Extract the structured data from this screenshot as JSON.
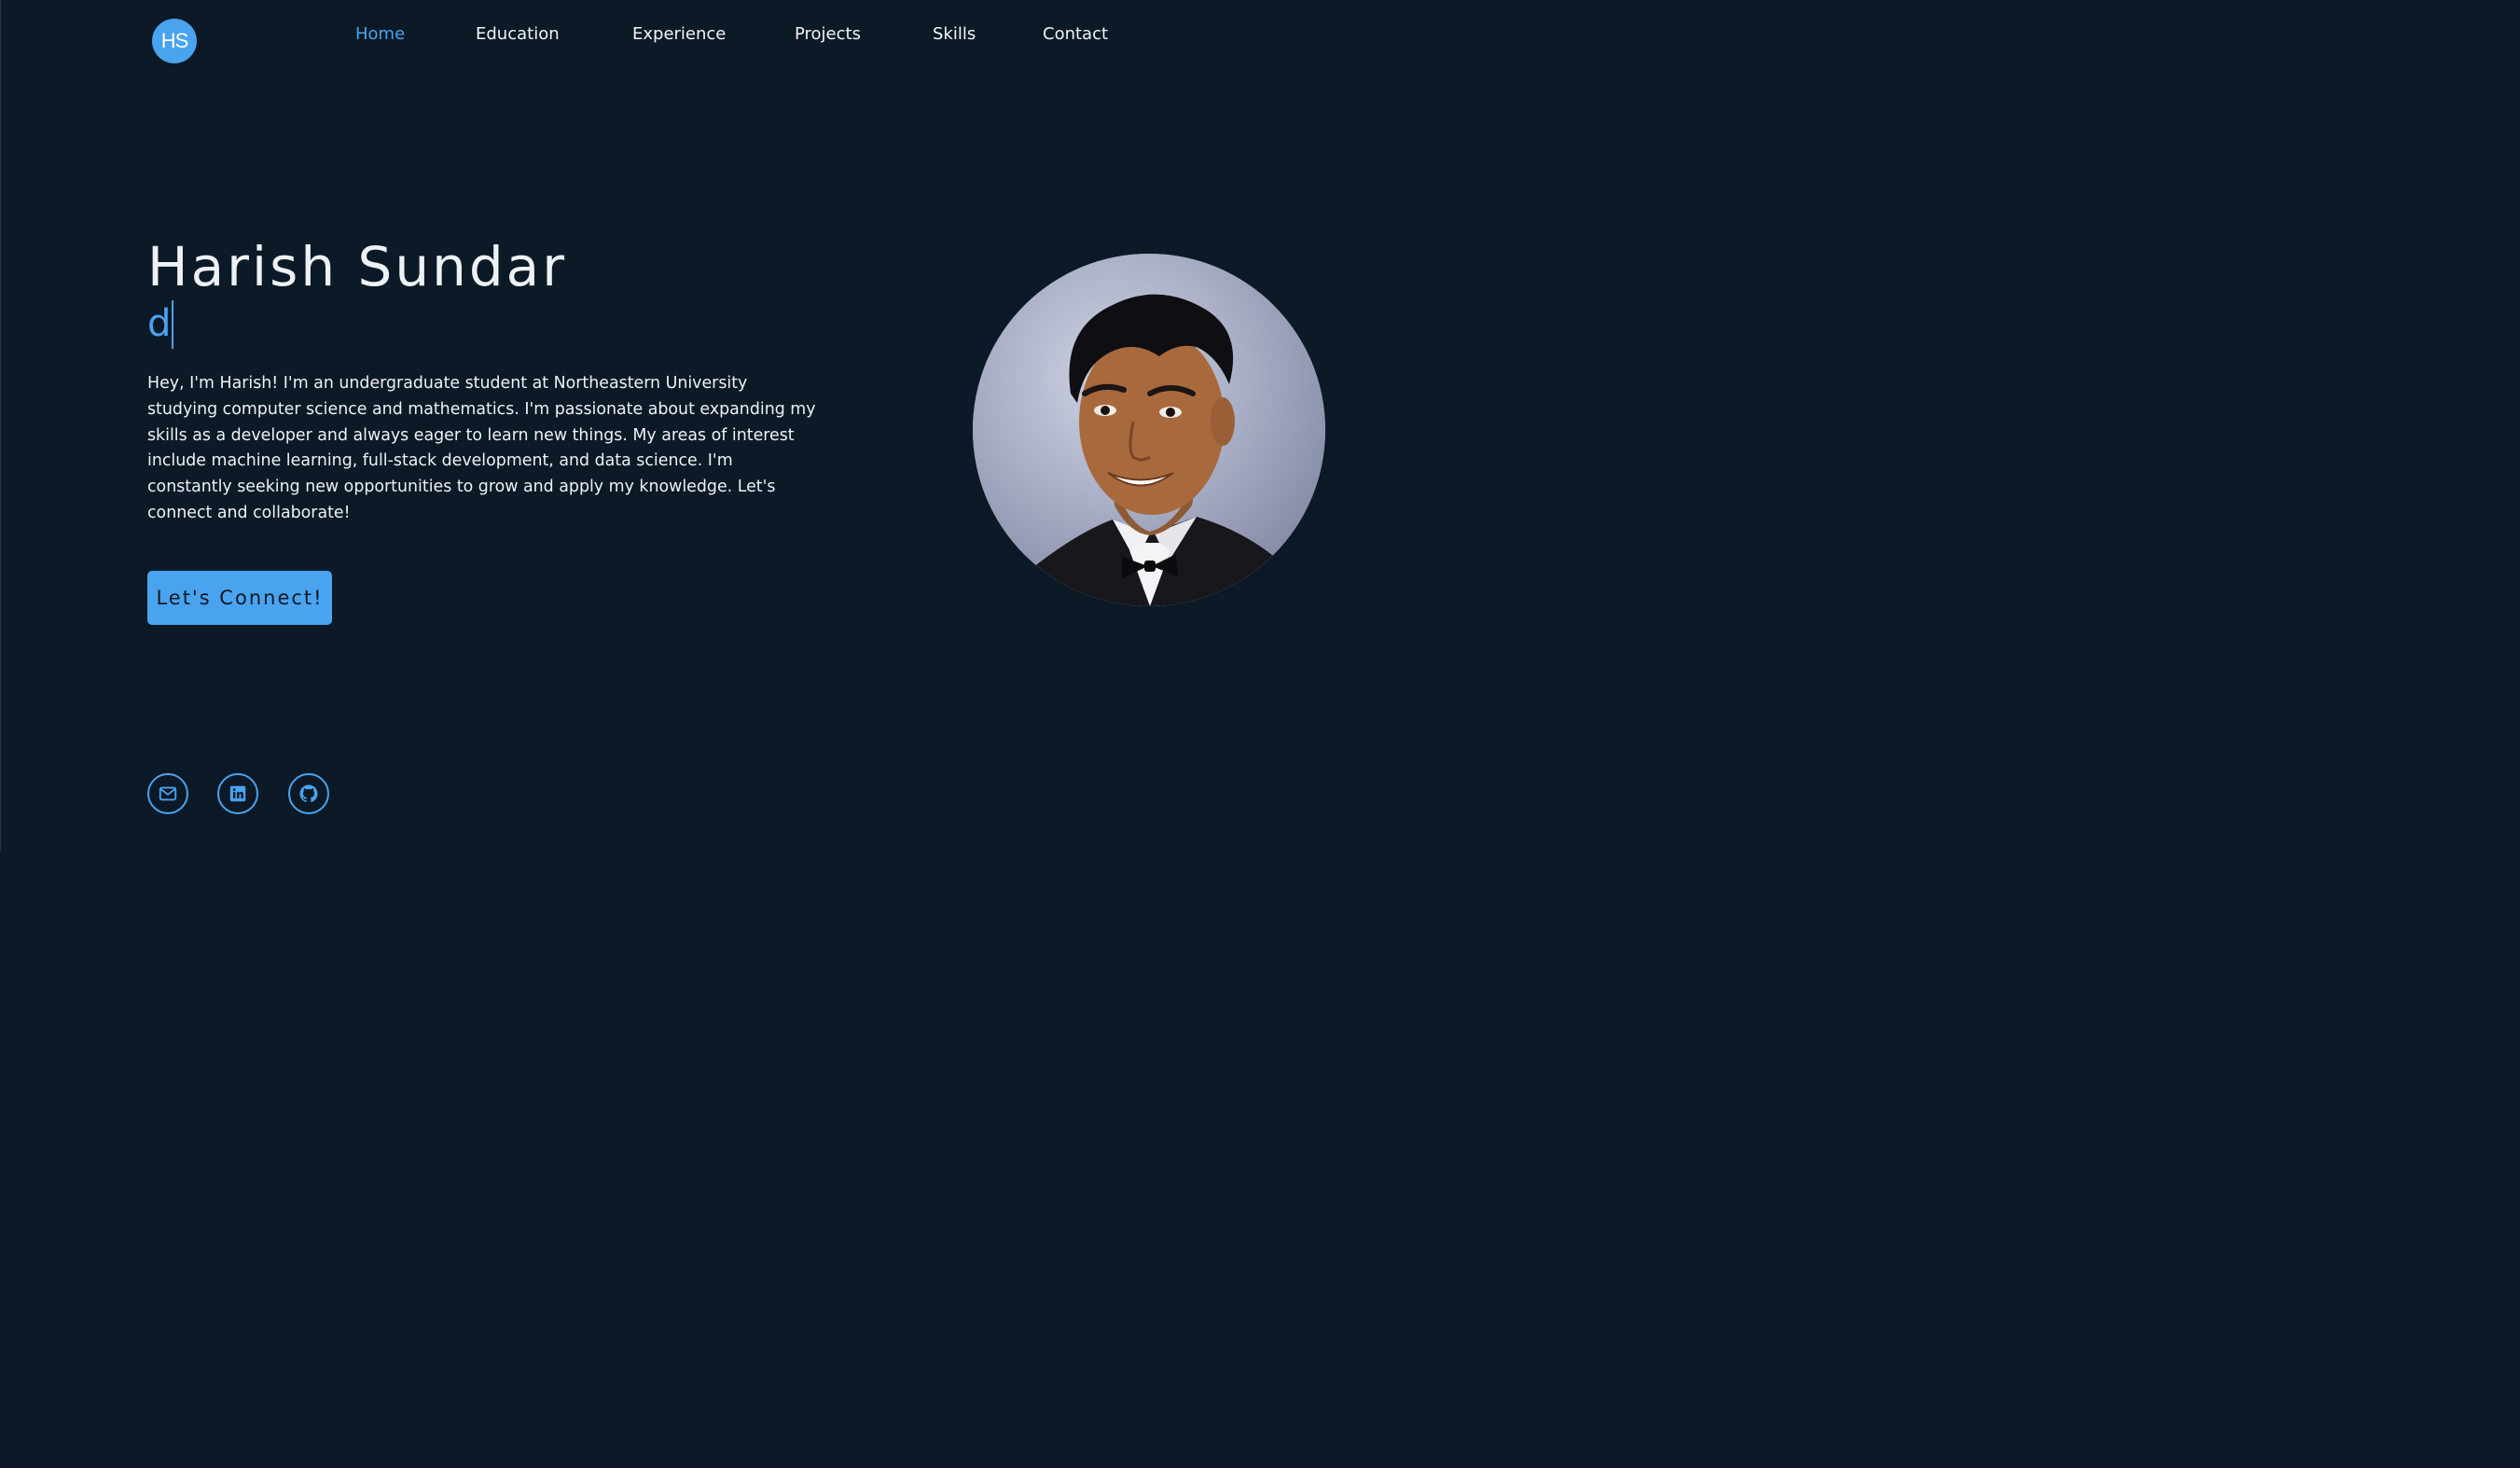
{
  "logo": {
    "initials": "HS"
  },
  "nav": {
    "items": [
      {
        "label": "Home",
        "active": true
      },
      {
        "label": "Education",
        "active": false
      },
      {
        "label": "Experience",
        "active": false
      },
      {
        "label": "Projects",
        "active": false
      },
      {
        "label": "Skills",
        "active": false
      },
      {
        "label": "Contact",
        "active": false
      }
    ]
  },
  "hero": {
    "name": "Harish Sundar",
    "typed_text": "d",
    "bio": "Hey, I'm Harish! I'm an undergraduate student at Northeastern University studying computer science and mathematics. I'm passionate about expanding my skills as a developer and always eager to learn new things. My areas of interest include machine learning, full-stack development, and data science. I'm constantly seeking new opportunities to grow and apply my knowledge. Let's connect and collaborate!",
    "cta_label": "Let's Connect!"
  },
  "portrait": {
    "icon": "profile-photo"
  },
  "social": [
    {
      "icon": "mail-icon"
    },
    {
      "icon": "linkedin-icon"
    },
    {
      "icon": "github-icon"
    }
  ],
  "colors": {
    "background": "#0c1927",
    "accent": "#4aa3ee",
    "text": "#eef1f5"
  }
}
